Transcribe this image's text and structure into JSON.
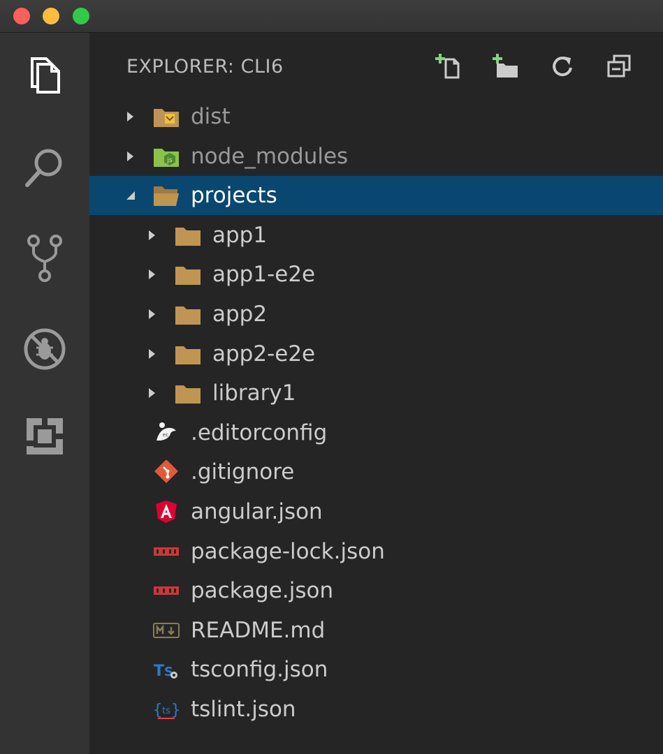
{
  "window": {
    "controls": [
      "close",
      "minimize",
      "maximize"
    ]
  },
  "activity_bar": {
    "items": [
      {
        "icon": "files-icon"
      },
      {
        "icon": "search-icon"
      },
      {
        "icon": "source-control-icon"
      },
      {
        "icon": "debug-icon"
      },
      {
        "icon": "extensions-icon"
      }
    ]
  },
  "explorer": {
    "title": "EXPLORER: CLI6",
    "actions": [
      {
        "icon": "new-file-icon"
      },
      {
        "icon": "new-folder-icon"
      },
      {
        "icon": "refresh-icon"
      },
      {
        "icon": "collapse-all-icon"
      }
    ],
    "tree": [
      {
        "label": "dist",
        "type": "folder",
        "expanded": false,
        "ignored": true,
        "icon": "dist-folder-icon"
      },
      {
        "label": "node_modules",
        "type": "folder",
        "expanded": false,
        "ignored": true,
        "icon": "node-folder-icon"
      },
      {
        "label": "projects",
        "type": "folder",
        "expanded": true,
        "selected": true,
        "icon": "open-folder-icon"
      },
      {
        "label": "app1",
        "type": "folder",
        "expanded": false,
        "icon": "folder-icon"
      },
      {
        "label": "app1-e2e",
        "type": "folder",
        "expanded": false,
        "icon": "folder-icon"
      },
      {
        "label": "app2",
        "type": "folder",
        "expanded": false,
        "icon": "folder-icon"
      },
      {
        "label": "app2-e2e",
        "type": "folder",
        "expanded": false,
        "icon": "folder-icon"
      },
      {
        "label": "library1",
        "type": "folder",
        "expanded": false,
        "icon": "folder-icon"
      },
      {
        "label": ".editorconfig",
        "type": "file",
        "icon": "editorconfig-icon"
      },
      {
        "label": ".gitignore",
        "type": "file",
        "icon": "git-icon"
      },
      {
        "label": "angular.json",
        "type": "file",
        "icon": "angular-icon"
      },
      {
        "label": "package-lock.json",
        "type": "file",
        "icon": "npm-icon"
      },
      {
        "label": "package.json",
        "type": "file",
        "icon": "npm-icon"
      },
      {
        "label": "README.md",
        "type": "file",
        "icon": "markdown-icon"
      },
      {
        "label": "tsconfig.json",
        "type": "file",
        "icon": "tsconfig-icon"
      },
      {
        "label": "tslint.json",
        "type": "file",
        "icon": "tslint-icon"
      }
    ]
  },
  "colors": {
    "selection": "#094771",
    "folder": "#c09553",
    "angular": "#dd0031",
    "npm": "#cb3837",
    "git": "#e05a3a",
    "typescript": "#3178c6",
    "new_icon_plus": "#89d185"
  }
}
